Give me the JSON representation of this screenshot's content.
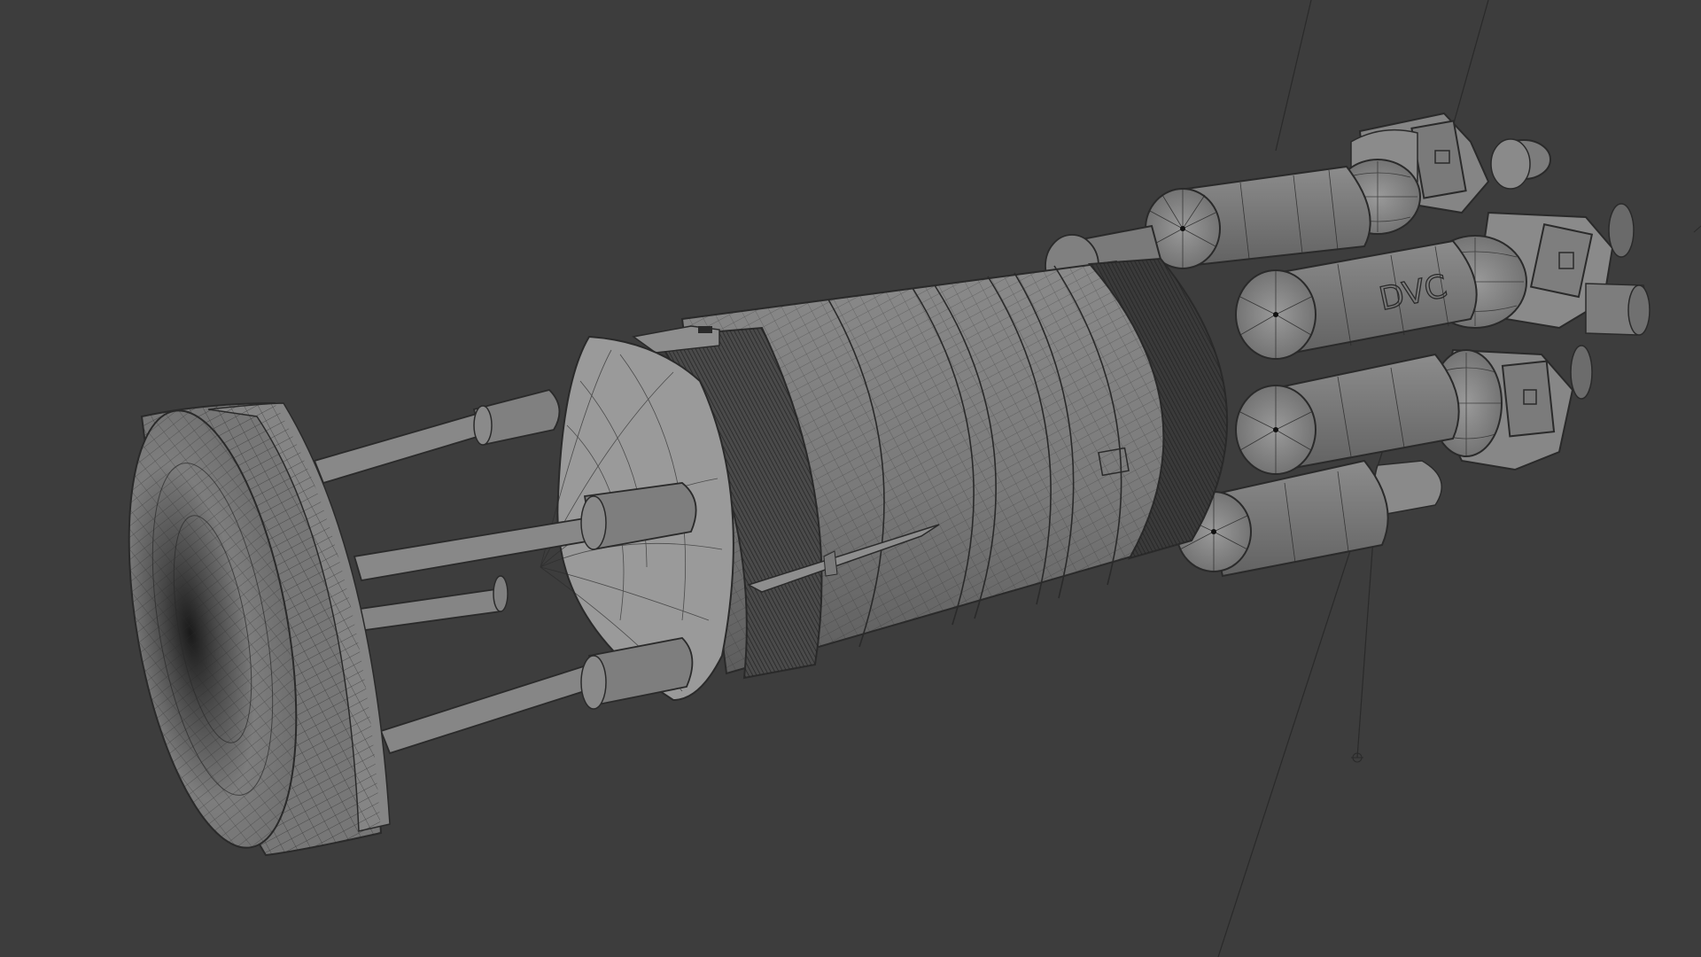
{
  "viewport": {
    "background_color": "#3d3d3d",
    "model": {
      "name": "ship-wireframe",
      "surface_color": "#7b7b7b",
      "wire_color": "#2a2a2a",
      "dense_wire_color": "#242424"
    },
    "stencil_text": "DVC",
    "labels": []
  }
}
